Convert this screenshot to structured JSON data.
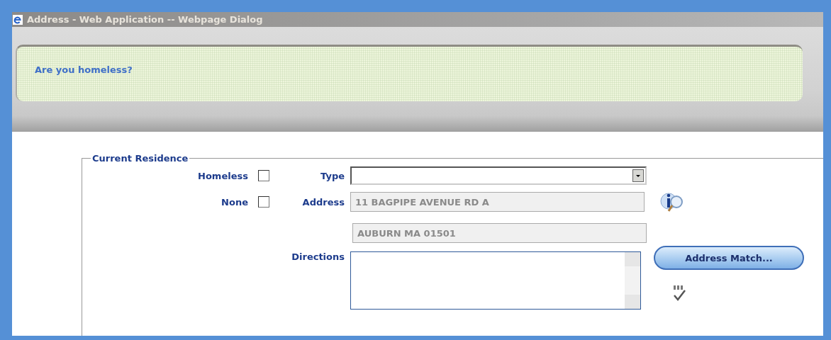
{
  "window": {
    "title": "Address - Web Application -- Webpage Dialog"
  },
  "message": "Are you homeless?",
  "fieldset": {
    "legend": "Current Residence",
    "checkboxes": [
      {
        "label": "Homeless",
        "checked": false
      },
      {
        "label": "None",
        "checked": false
      }
    ],
    "type": {
      "label": "Type"
    },
    "address": {
      "label": "Address",
      "line_1": "11 BAGPIPE AVENUE RD A",
      "line_2": "AUBURN MA 01501",
      "disabled": true
    },
    "directions": {
      "label": "Directions"
    },
    "address_match_button": "Address Match..."
  }
}
